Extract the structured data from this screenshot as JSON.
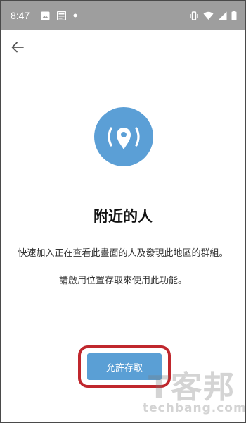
{
  "status_bar": {
    "time": "8:47",
    "left_icons": [
      "image-icon",
      "news-icon",
      "dot-icon"
    ],
    "right_icons": [
      "vibrate-icon",
      "wifi-icon",
      "signal-icon",
      "battery-icon"
    ]
  },
  "header": {
    "back_icon": "arrow-back-icon"
  },
  "main": {
    "title": "附近的人",
    "description": "快速加入正在查看此畫面的人及發現此地區的群組。",
    "permission_note": "請啟用位置存取來使用此功能。",
    "allow_button_label": "允許存取",
    "accent_color": "#5b9fd6",
    "highlight_color": "#c0272d"
  },
  "watermark": {
    "logo": "T客邦",
    "text": "techbang.com"
  }
}
